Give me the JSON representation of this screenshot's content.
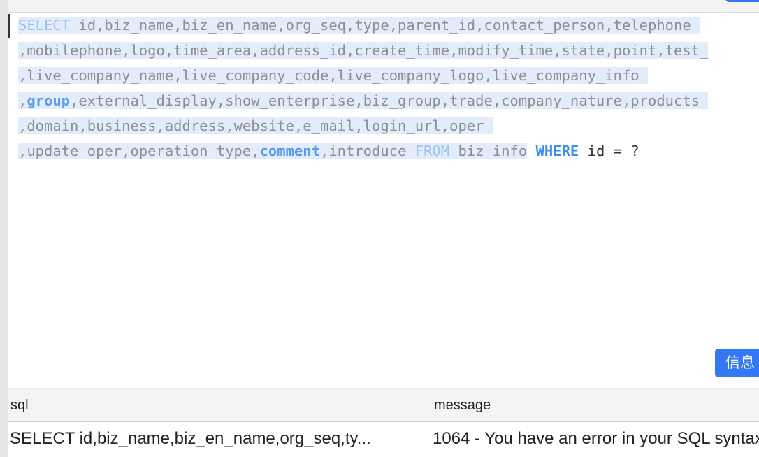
{
  "editor": {
    "lines": [
      [
        {
          "t": "SELECT",
          "c": "kw-sel"
        },
        {
          "t": " id,biz_name,biz_en_name,org_seq,type,parent_id,contact_person,telephone ",
          "c": "p"
        }
      ],
      [
        {
          "t": ",mobilephone,logo,time_area,address_id,create_time,modify_time,state,point,test_",
          "c": "p"
        }
      ],
      [
        {
          "t": ",live_company_name,live_company_code,live_company_logo,live_company_info ",
          "c": "p"
        }
      ],
      [
        {
          "t": ",",
          "c": "p"
        },
        {
          "t": "group",
          "c": "kw-sel-b"
        },
        {
          "t": ",external_display,show_enterprise,biz_group,trade,company_nature,products ",
          "c": "p"
        }
      ],
      [
        {
          "t": ",domain,business,address,website,e_mail,login_url,oper ",
          "c": "p"
        }
      ],
      [
        {
          "t": ",update_oper,operation_type,",
          "c": "p"
        },
        {
          "t": "comment",
          "c": "kw-sel-b"
        },
        {
          "t": ",introduce ",
          "c": "p"
        },
        {
          "t": "FROM",
          "c": "kw-sel"
        },
        {
          "t": " biz_info",
          "c": "p"
        },
        {
          "t": " ",
          "c": "u"
        },
        {
          "t": "WHERE",
          "c": "kw-b"
        },
        {
          "t": " id = ?",
          "c": "u-plain"
        }
      ]
    ]
  },
  "info_button": {
    "label": "信息"
  },
  "result_table": {
    "columns": [
      "sql",
      "message"
    ],
    "rows": [
      {
        "sql": "SELECT id,biz_name,biz_en_name,org_seq,ty...",
        "message": "1064 - You have an error in your SQL syntax"
      }
    ]
  }
}
